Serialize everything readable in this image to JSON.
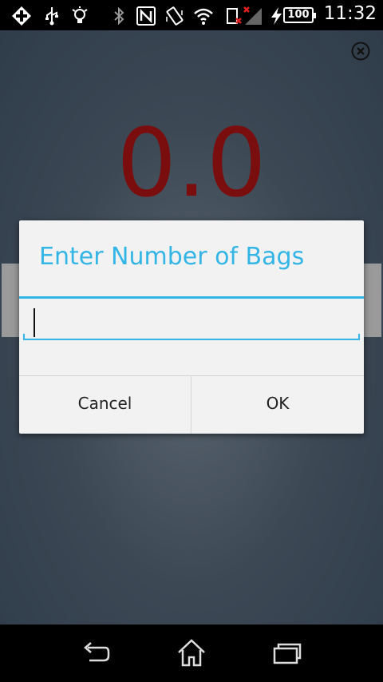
{
  "status_bar": {
    "time": "11:32",
    "battery": "100",
    "icons": [
      "add-notification-icon",
      "usb-icon",
      "lightbulb-icon",
      "bluetooth-icon",
      "nfc-icon",
      "rotate-icon",
      "wifi-icon",
      "sim-missing-icon",
      "signal-icon",
      "charging-icon"
    ]
  },
  "main": {
    "value": "0.0",
    "close_icon": "close-icon"
  },
  "dialog": {
    "title": "Enter Number of Bags",
    "input_value": "",
    "cancel_label": "Cancel",
    "ok_label": "OK"
  },
  "nav_bar": {
    "icons": [
      "back-icon",
      "home-icon",
      "recents-icon"
    ]
  },
  "colors": {
    "accent": "#33b5e5",
    "value_red": "#7a0e0e"
  }
}
